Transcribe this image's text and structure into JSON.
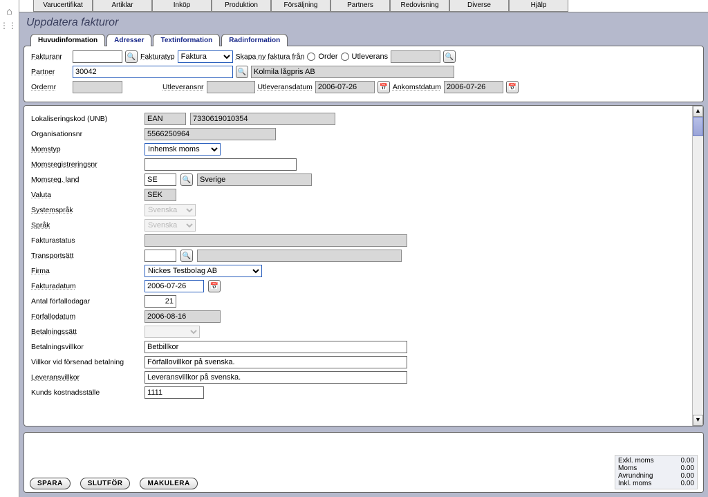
{
  "top_menu": [
    "Varucertifikat",
    "Artiklar",
    "Inköp",
    "Produktion",
    "Försäljning",
    "Partners",
    "Redovisning",
    "Diverse",
    "Hjälp"
  ],
  "page_title": "Uppdatera fakturor",
  "tabs": [
    "Huvudinformation",
    "Adresser",
    "Textinformation",
    "Radinformation"
  ],
  "header": {
    "fakturanr_label": "Fakturanr",
    "fakturanr_value": "",
    "fakturatyp_label": "Fakturatyp",
    "fakturatyp_value": "Faktura",
    "skapa_label": "Skapa ny faktura från",
    "order_label": "Order",
    "utleverans_label": "Utleverans",
    "partner_label": "Partner",
    "partner_value": "30042",
    "partner_name": "Kolmila lågpris AB",
    "ordernr_label": "Ordernr",
    "ordernr_value": "",
    "utleveransnr_label": "Utleveransnr",
    "utleveransnr_value": "",
    "utleveransdatum_label": "Utleveransdatum",
    "utleveransdatum_value": "2006-07-26",
    "ankomstdatum_label": "Ankomstdatum",
    "ankomstdatum_value": "2006-07-26"
  },
  "form": {
    "lokaliseringskod_label": "Lokaliseringskod (UNB)",
    "lokaliseringskod_type": "EAN",
    "lokaliseringskod_value": "7330619010354",
    "organisationsnr_label": "Organisationsnr",
    "organisationsnr_value": "5566250964",
    "momstyp_label": "Momstyp",
    "momstyp_value": "Inhemsk moms",
    "momsregistreringsnr_label": "Momsregistreringsnr",
    "momsregistreringsnr_value": "",
    "momsreg_land_label": "Momsreg. land",
    "momsreg_land_code": "SE",
    "momsreg_land_name": "Sverige",
    "valuta_label": "Valuta",
    "valuta_value": "SEK",
    "systemsprak_label": "Systemspråk",
    "systemsprak_value": "Svenska",
    "sprak_label": "Språk",
    "sprak_value": "Svenska",
    "fakturastatus_label": "Fakturastatus",
    "fakturastatus_value": "",
    "transportsatt_label": "Transportsätt",
    "transportsatt_code": "",
    "transportsatt_desc": "",
    "firma_label": "Firma",
    "firma_value": "Nickes Testbolag AB",
    "fakturadatum_label": "Fakturadatum",
    "fakturadatum_value": "2006-07-26",
    "antal_forfallodagar_label": "Antal förfallodagar",
    "antal_forfallodagar_value": "21",
    "forfallodatum_label": "Förfallodatum",
    "forfallodatum_value": "2006-08-16",
    "betalningssatt_label": "Betalningssätt",
    "betalningssatt_value": "",
    "betalningsvillkor_label": "Betalningsvillkor",
    "betalningsvillkor_value": "Betbillkor",
    "villkor_forsenad_label": "Villkor vid försenad betalning",
    "villkor_forsenad_value": "Förfallovillkor på svenska.",
    "leveransvillkor_label": "Leveransvillkor",
    "leveransvillkor_value": "Leveransvillkor på svenska.",
    "kunds_kostnadsstalle_label": "Kunds kostnadsställe",
    "kunds_kostnadsstalle_value": "1111"
  },
  "totals": {
    "exkl_moms_label": "Exkl. moms",
    "exkl_moms_value": "0.00",
    "moms_label": "Moms",
    "moms_value": "0.00",
    "avrundning_label": "Avrundning",
    "avrundning_value": "0.00",
    "inkl_moms_label": "Inkl. moms",
    "inkl_moms_value": "0.00"
  },
  "actions": {
    "spara": "SPARA",
    "slutfor": "SLUTFÖR",
    "makulera": "MAKULERA"
  }
}
